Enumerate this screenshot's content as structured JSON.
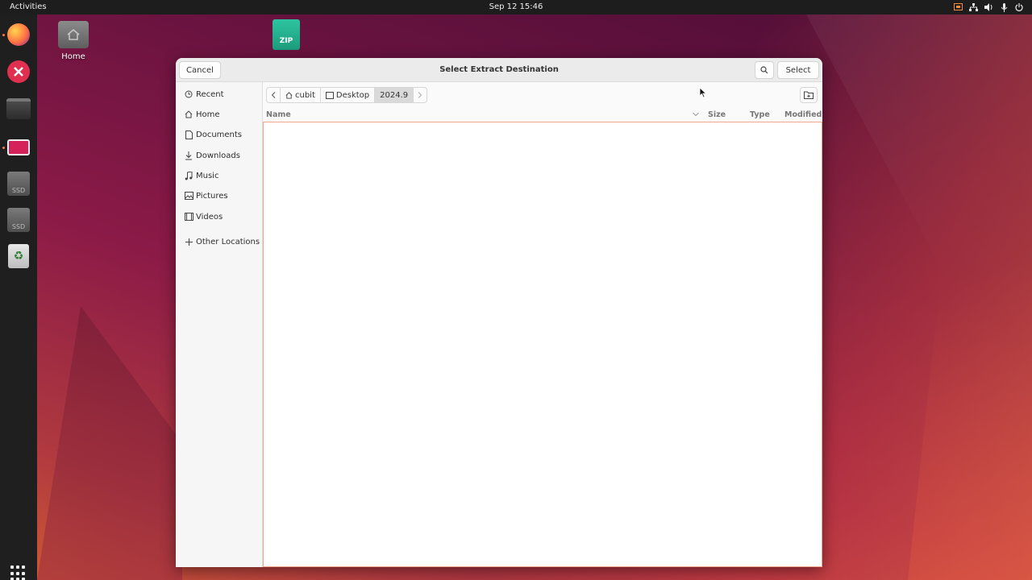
{
  "topbar": {
    "activities": "Activities",
    "datetime": "Sep 12  15:46",
    "tray_icons": [
      "screen-share-icon",
      "network-icon",
      "volume-icon",
      "microphone-icon",
      "power-icon"
    ]
  },
  "dock": {
    "items": [
      "firefox-icon",
      "beyond-compare-icon",
      "files-icon",
      "remote-desktop-icon",
      "ssd-drive-icon",
      "ssd-drive-icon",
      "trash-icon"
    ],
    "ssd_label": "SSD",
    "apps_button": "show-apps-icon"
  },
  "desktop": {
    "home_label": "Home",
    "zip_label": "ZIP"
  },
  "dialog": {
    "title": "Select Extract Destination",
    "cancel_label": "Cancel",
    "select_label": "Select",
    "sidebar": [
      {
        "label": "Recent",
        "icon": "clock-icon"
      },
      {
        "label": "Home",
        "icon": "home-icon"
      },
      {
        "label": "Documents",
        "icon": "document-icon"
      },
      {
        "label": "Downloads",
        "icon": "download-icon"
      },
      {
        "label": "Music",
        "icon": "music-icon"
      },
      {
        "label": "Pictures",
        "icon": "picture-icon"
      },
      {
        "label": "Videos",
        "icon": "video-icon"
      },
      {
        "label": "Other Locations",
        "icon": "plus-icon"
      }
    ],
    "path": [
      {
        "label": "cubit",
        "icon": "home-icon"
      },
      {
        "label": "Desktop",
        "icon": "desktop-icon"
      },
      {
        "label": "2024.9",
        "active": true
      }
    ],
    "columns": {
      "name": "Name",
      "size": "Size",
      "type": "Type",
      "modified": "Modified"
    }
  },
  "colors": {
    "accent": "#e95420",
    "topbar": "#1d1d1d",
    "dock": "#1f1f1f",
    "dialog_bg": "#fafafa"
  }
}
